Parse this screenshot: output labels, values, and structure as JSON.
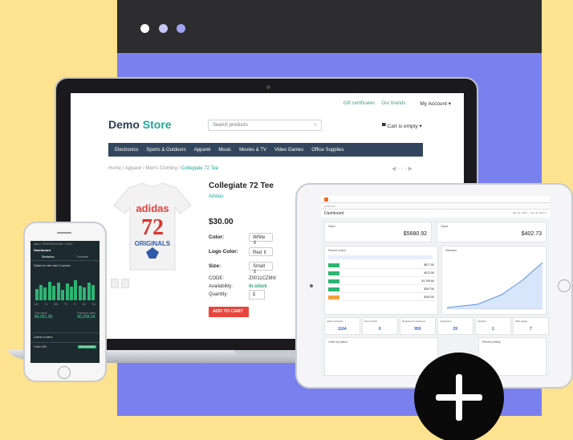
{
  "store": {
    "top_links": [
      "Gift certificates",
      "Our brands"
    ],
    "account": "My Account ▾",
    "logo_part1": "Demo",
    "logo_part2": "Store",
    "search_placeholder": "Search products",
    "cart": "Cart is empty ▾",
    "menu": [
      "Electronics",
      "Sports & Outdoors",
      "Apparel",
      "Music",
      "Movies & TV",
      "Video Games",
      "Office Supplies"
    ],
    "breadcrumb": "Home  /  Apparel  /  Men's Clothing  /",
    "breadcrumb_current": "Collegiate 72 Tee",
    "product": {
      "title": "Collegiate 72 Tee",
      "brand": "Adidas",
      "price": "$30.00",
      "color_label": "Color:",
      "color_value": "White ⇕",
      "logo_color_label": "Logo Color:",
      "logo_color_value": "Red ⇕",
      "size_label": "Size:",
      "size_value": "Small ⇕",
      "code_label": "CODE:",
      "code_value": "Z0011CZ8NI",
      "availability_label": "Availability:",
      "availability_value": "In stock",
      "quantity_label": "Quantity:",
      "quantity_value": "1",
      "add_to_cart": "ADD TO CART",
      "shirt_text_1": "adidas",
      "shirt_text_2": "72",
      "shirt_text_3": "ORIGINALS"
    }
  },
  "phone": {
    "status": "●●●○○ ROSTELECOM ≈  16:37",
    "title": "Dashboard",
    "tabs": [
      "Statistics",
      "Timeline"
    ],
    "subtitle": "Sales for the last 2 weeks",
    "bars": [
      0.55,
      0.75,
      0.6,
      0.9,
      0.7,
      0.85,
      0.5,
      0.8,
      0.65,
      0.95,
      0.7,
      0.6,
      0.85,
      0.75
    ],
    "days": [
      "Mo",
      "Tu",
      "We",
      "Th",
      "Fr",
      "Sa",
      "Su"
    ],
    "this_week_label": "This week",
    "this_week_value": "$4,061.38",
    "prev_week_label": "Previous week",
    "prev_week_value": "$5,258.34",
    "latest_label": "Latest orders",
    "order_label": "Order #95",
    "order_badge": "PROCESSED"
  },
  "tablet": {
    "dashboard": "Dashboard",
    "date_range": "Dec 30, 2016 — Jan 30, 2017 ▾",
    "sales_label": "Sales",
    "sales_value": "$5680.92",
    "taxes_label": "Taxes",
    "taxes_value": "$402.73",
    "recent_orders": "Recent orders",
    "statistics": "Statistics",
    "order_amounts": [
      "$577.50",
      "$472.50",
      "$1,799.64",
      "$297.50",
      "$192.50"
    ],
    "kpis": [
      {
        "label": "Active products",
        "value": "1164"
      },
      {
        "label": "Out of stock",
        "value": "0"
      },
      {
        "label": "Registered customers",
        "value": "959"
      },
      {
        "label": "Categories",
        "value": "29"
      },
      {
        "label": "Vendors",
        "value": "1"
      },
      {
        "label": "Web pages",
        "value": "7"
      }
    ],
    "orders_by_status": "Order by status",
    "recent_activity": "Recent activity"
  }
}
